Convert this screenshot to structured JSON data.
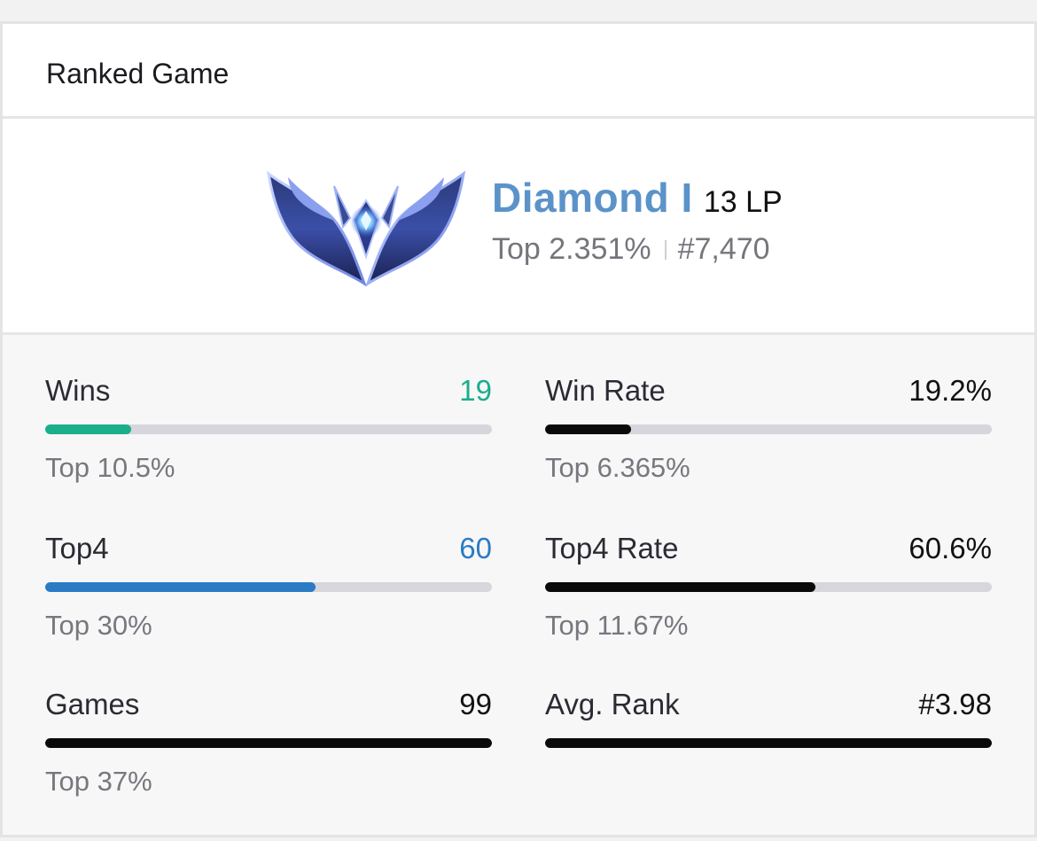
{
  "header": {
    "title": "Ranked Game"
  },
  "tier": {
    "name": "Diamond I",
    "lp": "13 LP",
    "top_percent": "Top 2.351%",
    "rank": "#7,470",
    "emblem_icon": "diamond-rank-emblem-icon"
  },
  "stats": [
    {
      "label": "Wins",
      "value": "19",
      "value_color": "#1aae8b",
      "bar_fraction": 0.192,
      "bar_color": "#1aae8b",
      "footer": "Top 10.5%"
    },
    {
      "label": "Win Rate",
      "value": "19.2%",
      "value_color": "#111111",
      "bar_fraction": 0.192,
      "bar_color": "#0a0a0a",
      "footer": "Top 6.365%"
    },
    {
      "label": "Top4",
      "value": "60",
      "value_color": "#2a7bc4",
      "bar_fraction": 0.606,
      "bar_color": "#2a7bc4",
      "footer": "Top 30%"
    },
    {
      "label": "Top4 Rate",
      "value": "60.6%",
      "value_color": "#111111",
      "bar_fraction": 0.606,
      "bar_color": "#0a0a0a",
      "footer": "Top 11.67%"
    },
    {
      "label": "Games",
      "value": "99",
      "value_color": "#111111",
      "bar_fraction": 1.0,
      "bar_color": "#0a0a0a",
      "footer": "Top 37%"
    },
    {
      "label": "Avg. Rank",
      "value": "#3.98",
      "value_color": "#111111",
      "bar_fraction": 1.0,
      "bar_color": "#0a0a0a",
      "footer": ""
    }
  ]
}
